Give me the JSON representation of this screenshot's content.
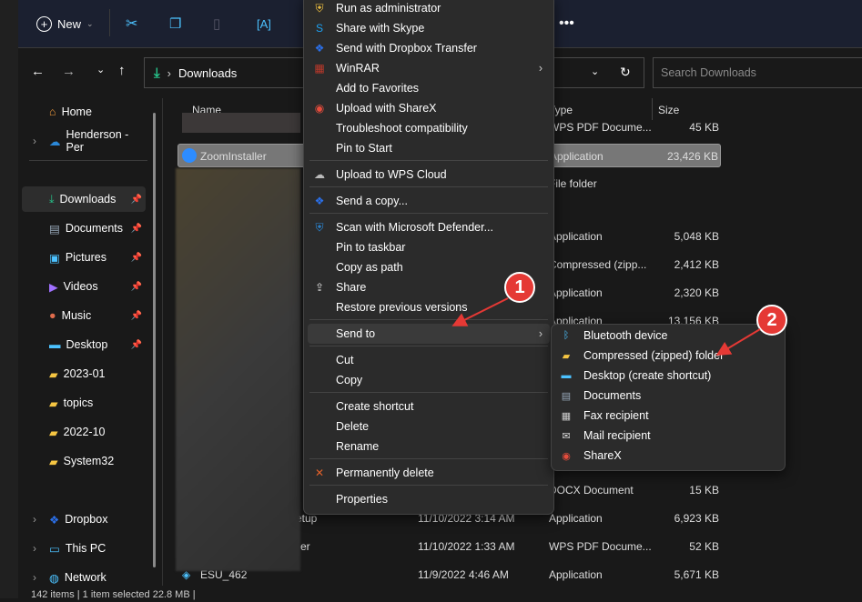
{
  "toolbar": {
    "new_label": "New"
  },
  "address": {
    "crumb": "Downloads",
    "search_placeholder": "Search Downloads"
  },
  "columns": {
    "name": "Name",
    "type": "Type",
    "size": "Size"
  },
  "sidebar": [
    {
      "label": "Home"
    },
    {
      "label": "Henderson - Per"
    },
    {
      "label": "Downloads"
    },
    {
      "label": "Documents"
    },
    {
      "label": "Pictures"
    },
    {
      "label": "Videos"
    },
    {
      "label": "Music"
    },
    {
      "label": "Desktop"
    },
    {
      "label": "2023-01"
    },
    {
      "label": "topics"
    },
    {
      "label": "2022-10"
    },
    {
      "label": "System32"
    },
    {
      "label": "Dropbox"
    },
    {
      "label": "This PC"
    },
    {
      "label": "Network"
    }
  ],
  "files": [
    {
      "name": "",
      "date": "",
      "type": "WPS PDF Docume...",
      "size": "45 KB"
    },
    {
      "name": "ZoomInstaller",
      "date": "",
      "type": "Application",
      "size": "23,426 KB"
    },
    {
      "name": "",
      "date": "",
      "type": "File folder",
      "size": ""
    },
    {
      "name": "",
      "date": "",
      "type": "Application",
      "size": "5,048 KB"
    },
    {
      "name": "",
      "date": "",
      "type": "Compressed (zipp...",
      "size": "2,412 KB"
    },
    {
      "name": "",
      "date": "",
      "type": "Application",
      "size": "2,320 KB"
    },
    {
      "name": "",
      "date": "",
      "type": "Application",
      "size": "13,156 KB"
    },
    {
      "name": "",
      "date": "",
      "type": "DOCX Document",
      "size": "15 KB"
    },
    {
      "name": "etup",
      "date": "11/10/2022 3:14 AM",
      "type": "Application",
      "size": "6,923 KB"
    },
    {
      "name": "er",
      "date": "11/10/2022 1:33 AM",
      "type": "WPS PDF Docume...",
      "size": "52 KB"
    },
    {
      "name": "ESU_462",
      "date": "11/9/2022 4:46 AM",
      "type": "Application",
      "size": "5,671 KB"
    }
  ],
  "menu": [
    "Run as administrator",
    "Share with Skype",
    "Send with Dropbox Transfer",
    "WinRAR",
    "Add to Favorites",
    "Upload with ShareX",
    "Troubleshoot compatibility",
    "Pin to Start",
    "Upload to WPS Cloud",
    "Send a copy...",
    "Scan with Microsoft Defender...",
    "Pin to taskbar",
    "Copy as path",
    "Share",
    "Restore previous versions",
    "Send to",
    "Cut",
    "Copy",
    "Create shortcut",
    "Delete",
    "Rename",
    "Permanently delete",
    "Properties"
  ],
  "submenu": [
    "Bluetooth device",
    "Compressed (zipped) folder",
    "Desktop (create shortcut)",
    "Documents",
    "Fax recipient",
    "Mail recipient",
    "ShareX"
  ],
  "annotations": {
    "one": "1",
    "two": "2"
  },
  "status": "142 items  |  1 item selected  22.8 MB  |",
  "colors": {
    "accent": "#4cc2ff",
    "annotation": "#e53935"
  }
}
